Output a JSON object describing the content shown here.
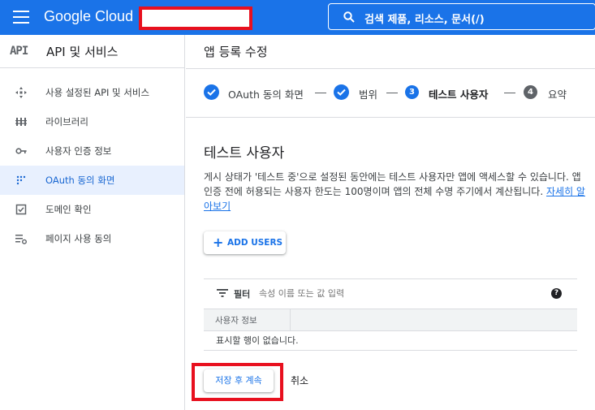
{
  "topbar": {
    "brand": "Google Cloud",
    "search_text": "검색  제품, 리소스, 문서(/)"
  },
  "sidebar": {
    "logo_text": "API",
    "title": "API 및 서비스",
    "items": [
      {
        "label": "사용 설정된 API 및 서비스",
        "icon": "diamond-arrows-icon"
      },
      {
        "label": "라이브러리",
        "icon": "library-icon"
      },
      {
        "label": "사용자 인증 정보",
        "icon": "key-icon"
      },
      {
        "label": "OAuth 동의 화면",
        "icon": "dots-grid-icon",
        "active": true
      },
      {
        "label": "도메인 확인",
        "icon": "checkbox-icon"
      },
      {
        "label": "페이지 사용 동의",
        "icon": "settings-list-icon"
      }
    ]
  },
  "main": {
    "page_title": "앱 등록 수정",
    "steps": [
      {
        "label": "OAuth 동의 화면",
        "state": "done"
      },
      {
        "label": "범위",
        "state": "done"
      },
      {
        "number": "3",
        "label": "테스트 사용자",
        "state": "current"
      },
      {
        "number": "4",
        "label": "요약",
        "state": "pending"
      }
    ],
    "section_title": "테스트 사용자",
    "description": "게시 상태가 '테스트 중'으로 설정된 동안에는 테스트 사용자만 앱에 액세스할 수 있습니다. 앱 인증 전에 허용되는 사용자 한도는 100명이며 앱의 전체 수명 주기에서 계산됩니다.",
    "learn_more": "자세히 알아보기",
    "add_users_label": "ADD USERS",
    "filter_label": "필터",
    "filter_placeholder": "속성 이름 또는 값 입력",
    "help_glyph": "?",
    "table_header": "사용자 정보",
    "empty_text": "표시할 행이 없습니다.",
    "save_label": "저장 후 계속",
    "cancel_label": "취소"
  },
  "colors": {
    "brand_blue": "#1a73e8",
    "highlight_red": "#e8101e",
    "active_bg": "#e8f0fe"
  }
}
